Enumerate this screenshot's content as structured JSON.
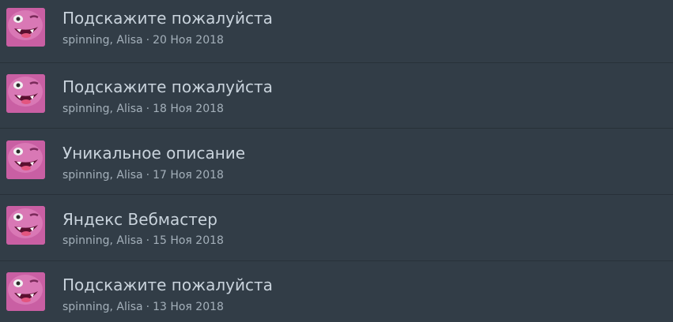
{
  "threads": [
    {
      "title": "Подскажите пожалуйста",
      "authors": "spinning, Alisa",
      "separator": "·",
      "date": "20 Ноя 2018"
    },
    {
      "title": "Подскажите пожалуйста",
      "authors": "spinning, Alisa",
      "separator": "·",
      "date": "18 Ноя 2018"
    },
    {
      "title": "Уникальное описание",
      "authors": "spinning, Alisa",
      "separator": "·",
      "date": "17 Ноя 2018"
    },
    {
      "title": "Яндекс Вебмастер",
      "authors": "spinning, Alisa",
      "separator": "·",
      "date": "15 Ноя 2018"
    },
    {
      "title": "Подскажите пожалуйста",
      "authors": "spinning, Alisa",
      "separator": "·",
      "date": "13 Ноя 2018"
    }
  ],
  "avatar": {
    "icon": "winking-monster-avatar-icon",
    "color": "#c75aa0"
  },
  "colors": {
    "background": "#323d47",
    "title": "#c9d3dc",
    "meta": "#a4b0ba",
    "divider": "#283139"
  }
}
